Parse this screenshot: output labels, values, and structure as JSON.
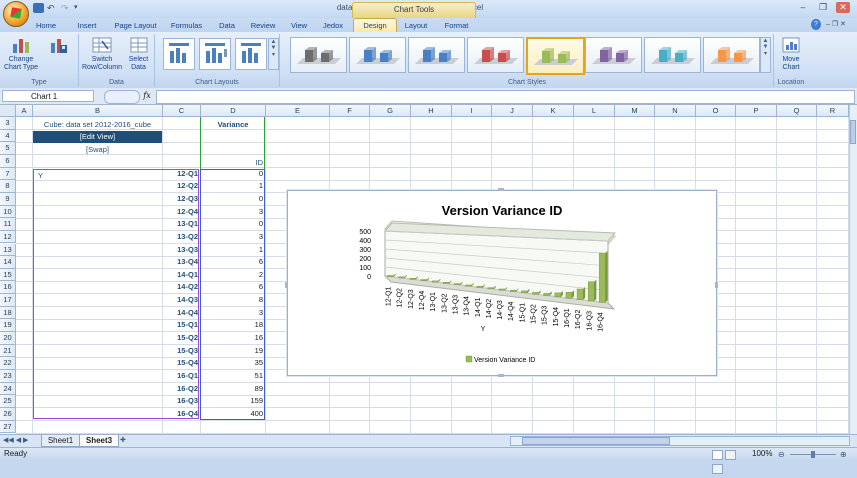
{
  "window": {
    "title": "data set 2012-2016.xlsx - Microsoft Excel",
    "context_tab": "Chart Tools",
    "minimize": "–",
    "restore": "❐",
    "close": "✕",
    "help": "?"
  },
  "tabs": [
    "Home",
    "Insert",
    "Page Layout",
    "Formulas",
    "Data",
    "Review",
    "View",
    "Jedox",
    "Design",
    "Layout",
    "Format"
  ],
  "active_tab": "Design",
  "ribbon": {
    "type_group": {
      "label": "Type",
      "change_chart_type": "Change Chart Type",
      "save_as_template": "Save As Template"
    },
    "data_group": {
      "label": "Data",
      "switch_row_column": "Switch Row/Column",
      "select_data": "Select Data"
    },
    "chart_layouts_label": "Chart Layouts",
    "chart_styles_label": "Chart Styles",
    "chart_style_colors": [
      "#6d6d6d",
      "#4a7fc1",
      "#4a7fc1",
      "#c94d4d",
      "#9bbb59",
      "#8064a2",
      "#4bacc6",
      "#f79646"
    ],
    "selected_style_index": 4,
    "location_group": {
      "label": "Location",
      "move_chart": "Move Chart"
    }
  },
  "formula_bar": {
    "name_box": "Chart 1",
    "fx": "fx",
    "formula": ""
  },
  "columns": [
    "A",
    "B",
    "C",
    "D",
    "E",
    "F",
    "G",
    "H",
    "I",
    "J",
    "K",
    "L",
    "M",
    "N",
    "O",
    "P",
    "Q",
    "R"
  ],
  "rows": [
    "3",
    "4",
    "5",
    "6",
    "7",
    "8",
    "9",
    "10",
    "11",
    "12",
    "13",
    "14",
    "15",
    "16",
    "17",
    "18",
    "19",
    "20",
    "21",
    "22",
    "23",
    "24",
    "25",
    "26",
    "27"
  ],
  "sheet": {
    "cube_label": "Cube: data set 2012-2016_cube",
    "edit_view": "[Edit View]",
    "swap": "[Swap]",
    "variance_header": "Variance",
    "id_header": "ID",
    "y_label": "Y",
    "quarters": [
      "12-Q1",
      "12-Q2",
      "12-Q3",
      "12-Q4",
      "13-Q1",
      "13-Q2",
      "13-Q3",
      "13-Q4",
      "14-Q1",
      "14-Q2",
      "14-Q3",
      "14-Q4",
      "15-Q1",
      "15-Q2",
      "15-Q3",
      "15-Q4",
      "16-Q1",
      "16-Q2",
      "16-Q3",
      "16-Q4"
    ],
    "values": [
      "0",
      "1",
      "0",
      "3",
      "0",
      "3",
      "1",
      "6",
      "2",
      "6",
      "8",
      "3",
      "18",
      "16",
      "19",
      "35",
      "51",
      "89",
      "159",
      "400"
    ]
  },
  "chart_data": {
    "type": "bar",
    "title": "Version Variance ID",
    "xlabel": "Y",
    "ylabel": "",
    "categories": [
      "12-Q1",
      "12-Q2",
      "12-Q3",
      "12-Q4",
      "13-Q1",
      "13-Q2",
      "13-Q3",
      "13-Q4",
      "14-Q1",
      "14-Q2",
      "14-Q3",
      "14-Q4",
      "15-Q1",
      "15-Q2",
      "15-Q3",
      "15-Q4",
      "16-Q1",
      "16-Q2",
      "16-Q3",
      "16-Q4"
    ],
    "series": [
      {
        "name": "Version Variance ID",
        "values": [
          0,
          1,
          0,
          3,
          0,
          3,
          1,
          6,
          2,
          6,
          8,
          3,
          18,
          16,
          19,
          35,
          51,
          89,
          159,
          400
        ]
      }
    ],
    "ylim": [
      0,
      500
    ],
    "yticks": [
      "500",
      "400",
      "300",
      "200",
      "100",
      "0"
    ],
    "legend_position": "bottom",
    "bar_color": "#9bbb59"
  },
  "sheet_tabs": [
    "Sheet1",
    "Sheet3"
  ],
  "active_sheet": "Sheet3",
  "status": {
    "mode": "Ready",
    "zoom": "100%"
  }
}
